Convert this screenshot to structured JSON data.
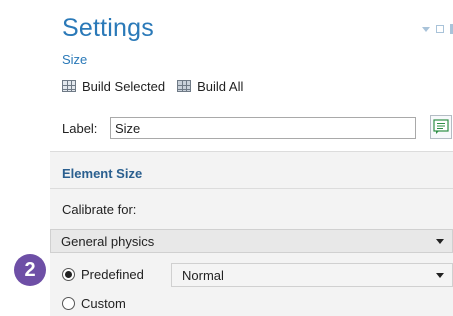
{
  "step_badge": "2",
  "settings": {
    "title": "Settings",
    "subtitle": "Size",
    "toolbar": {
      "build_selected_label": "Build Selected",
      "build_all_label": "Build All"
    },
    "label_field": {
      "label": "Label:",
      "value": "Size"
    },
    "element_size": {
      "section_title": "Element Size",
      "calibrate_label": "Calibrate for:",
      "calibrate_value": "General physics",
      "options": {
        "predefined_label": "Predefined",
        "predefined_value": "Normal",
        "custom_label": "Custom"
      },
      "selected_option": "predefined"
    }
  }
}
